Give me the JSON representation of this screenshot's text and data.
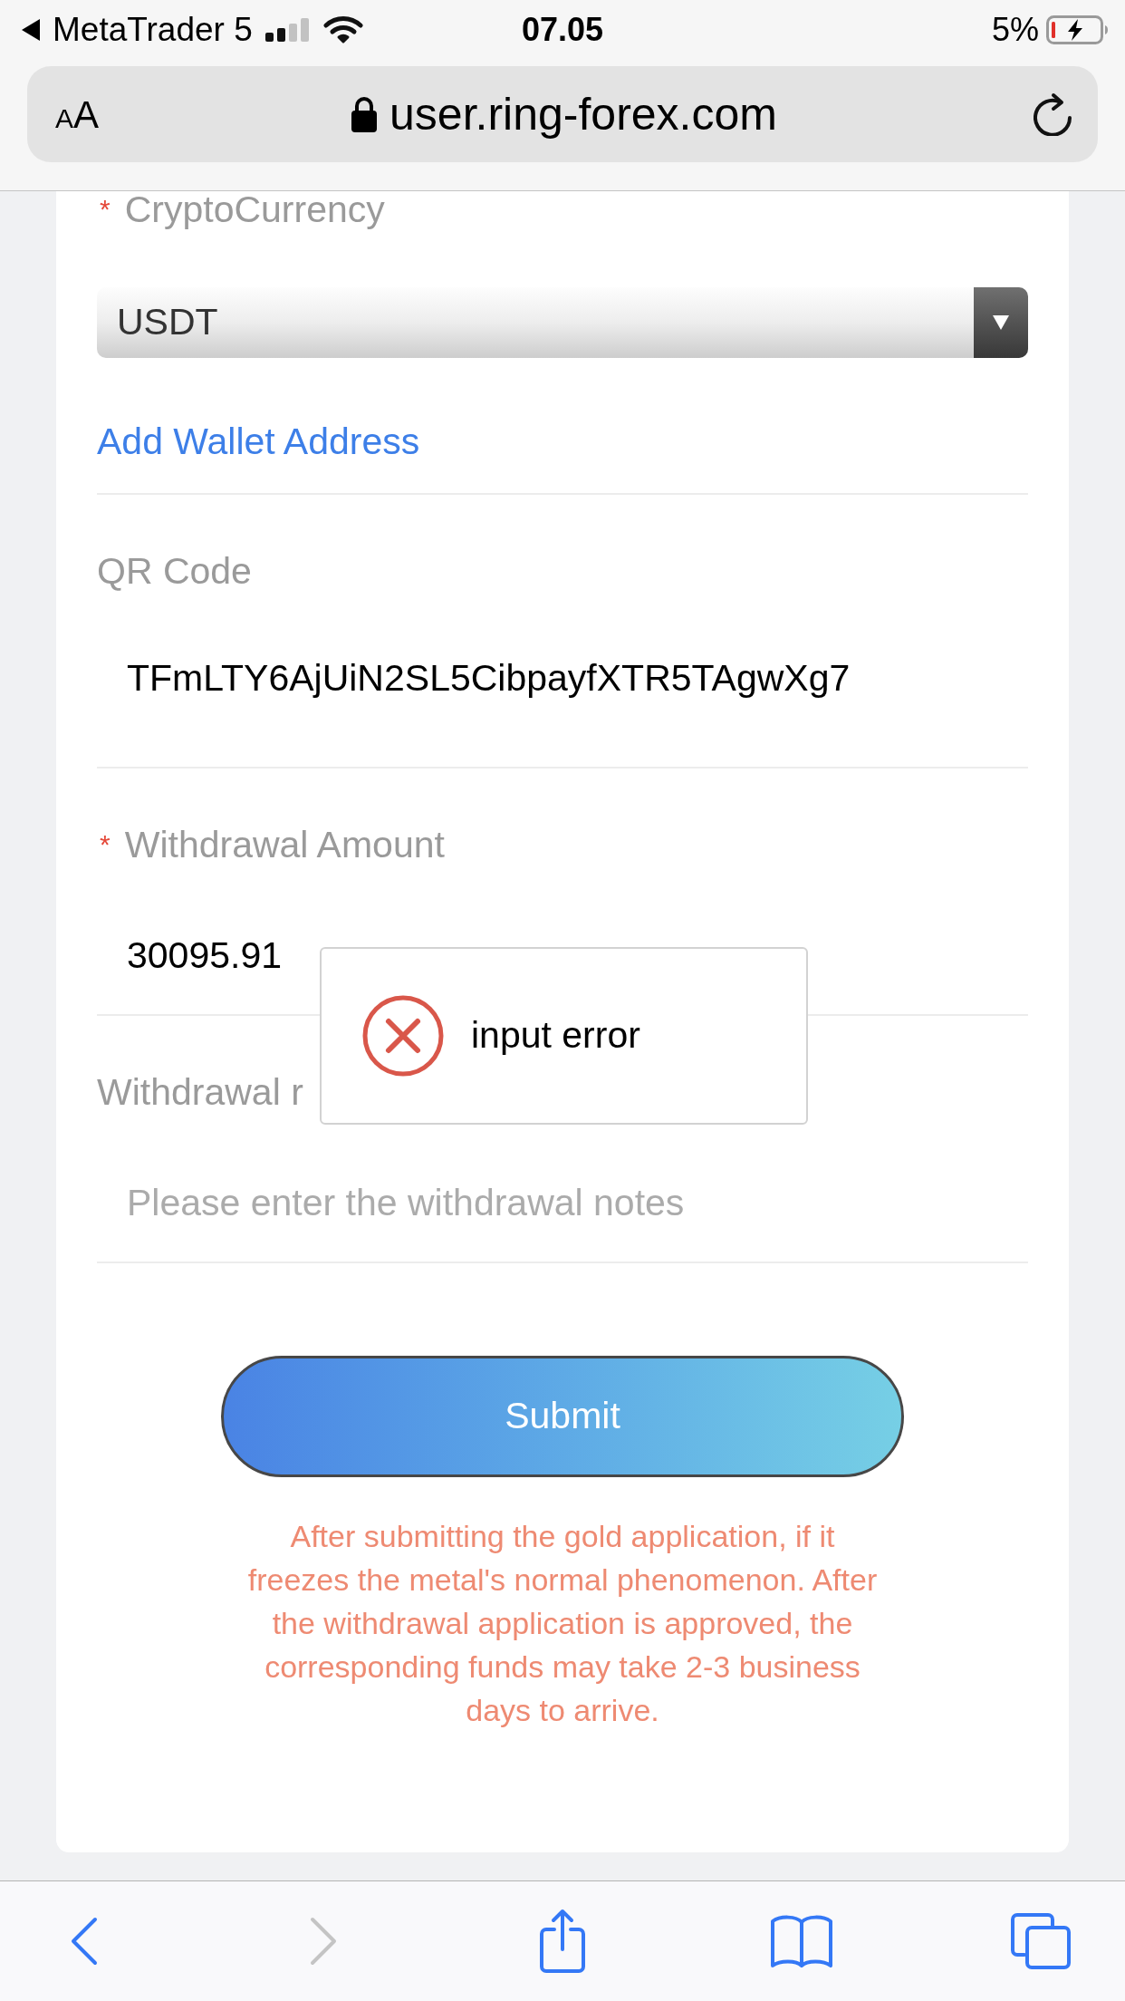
{
  "status_bar": {
    "back_app": "MetaTrader 5",
    "time": "07.05",
    "battery": "5%"
  },
  "address_bar": {
    "text_size": "AA",
    "url": "user.ring-forex.com"
  },
  "form": {
    "fields": [
      {
        "kind": "select",
        "required_mark": "*",
        "label": "CryptoCurrency",
        "value": "USDT"
      },
      {
        "kind": "link",
        "label": "Add Wallet Address"
      },
      {
        "kind": "display",
        "label": "QR Code",
        "value": "TFmLTY6AjUiN2SL5CibpayfXTR5TAgwXg7"
      },
      {
        "kind": "input",
        "required_mark": "*",
        "label": "Withdrawal Amount",
        "value": "30095.91"
      },
      {
        "kind": "input",
        "label": "Withdrawal r",
        "placeholder": "Please enter the withdrawal notes"
      }
    ],
    "submit": "Submit",
    "notice": "After submitting the gold application, if it freezes the metal's normal phenomenon. After the withdrawal application is approved, the corresponding funds may take 2-3 business days to arrive."
  },
  "dialog": {
    "kind": "error",
    "message": "input error"
  },
  "toolbar": [
    {
      "kind": "back",
      "disabled": false
    },
    {
      "kind": "forward",
      "disabled": true
    },
    {
      "kind": "share",
      "disabled": false
    },
    {
      "kind": "bookmarks",
      "disabled": false
    },
    {
      "kind": "tabs",
      "disabled": false
    }
  ]
}
